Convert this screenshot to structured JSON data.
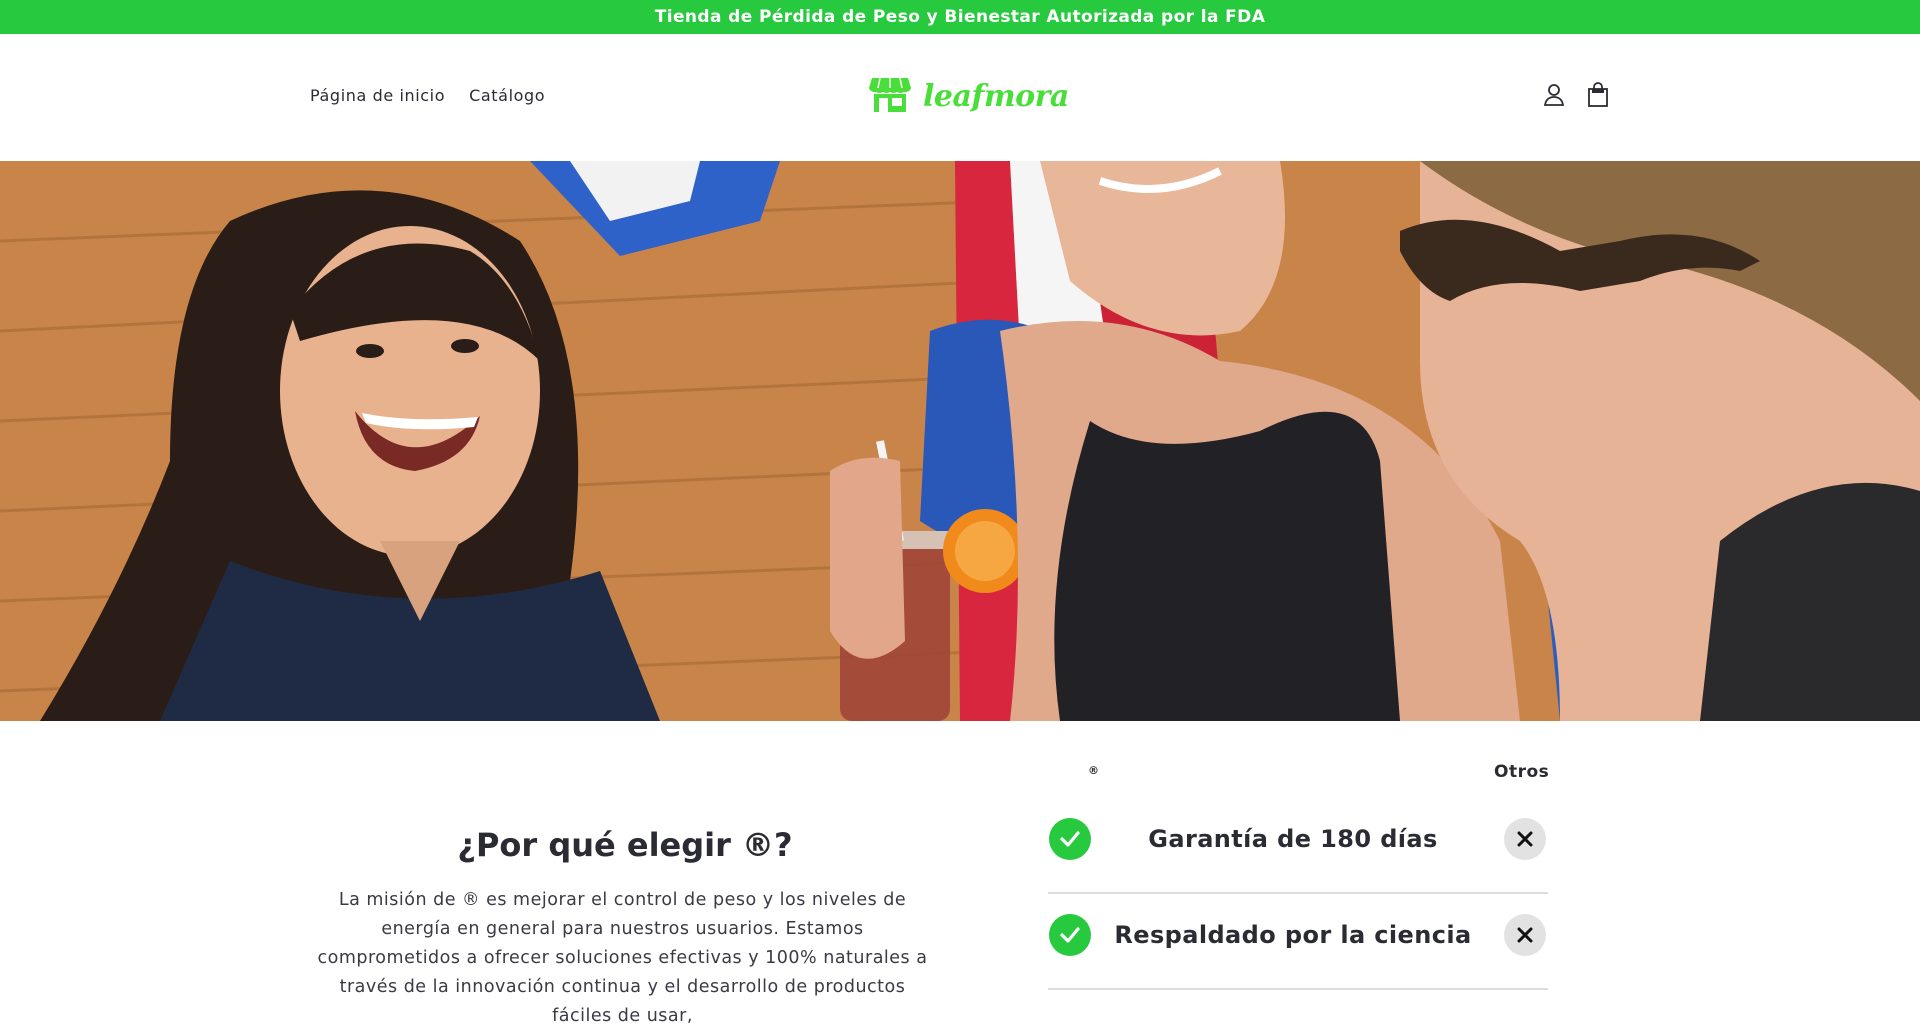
{
  "announcement": {
    "text": "Tienda de Pérdida de Peso y Bienestar Autorizada por la FDA"
  },
  "nav": {
    "items": [
      "Página de inicio",
      "Catálogo"
    ]
  },
  "logo": {
    "text": "leafmora",
    "icon": "storefront-icon"
  },
  "header_icons": [
    "user-account-icon",
    "shopping-bag-icon"
  ],
  "why": {
    "title": "¿Por qué elegir ®?",
    "text": "La misión de ® es mejorar el control de peso y los niveles de energía en general para nuestros usuarios. Estamos comprometidos a ofrecer soluciones efectivas y 100% naturales a través de la innovación continua y el desarrollo de productos fáciles de usar,"
  },
  "comparison": {
    "left_header": "®",
    "right_header": "Otros",
    "rows": [
      {
        "label": "Garantía de 180 días"
      },
      {
        "label": "Respaldado por la ciencia"
      }
    ]
  },
  "colors": {
    "accent": "#27c93f",
    "logo": "#4ade3a",
    "text": "#2b2b33"
  }
}
